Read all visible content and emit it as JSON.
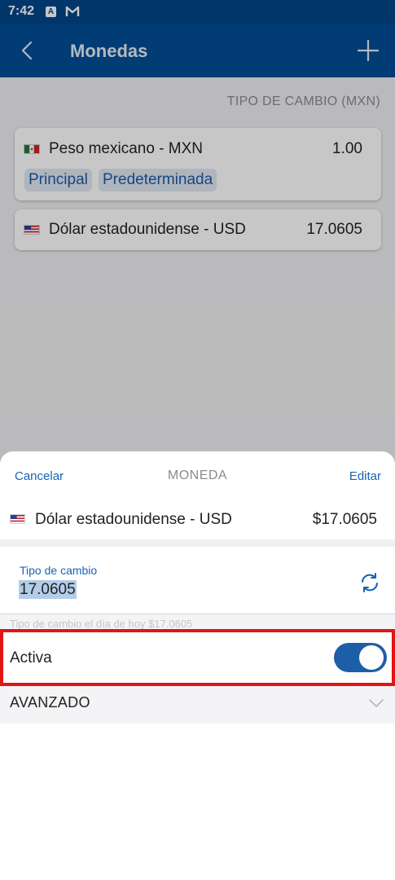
{
  "status_bar": {
    "time": "7:42",
    "icons": [
      "a-icon",
      "gmail-icon"
    ],
    "a_glyph": "A"
  },
  "app_bar": {
    "title": "Monedas",
    "back_icon": "chevron-left-icon",
    "add_icon": "plus-icon"
  },
  "list": {
    "rate_header": "TIPO DE CAMBIO (MXN)",
    "currencies": [
      {
        "flag": "mexico-flag-icon",
        "name": "Peso mexicano - MXN",
        "rate": "1.00",
        "tags": [
          "Principal",
          "Predeterminada"
        ]
      },
      {
        "flag": "usa-flag-icon",
        "name": "Dólar estadounidense - USD",
        "rate": "17.0605",
        "tags": []
      }
    ]
  },
  "sheet": {
    "cancel_label": "Cancelar",
    "title": "MONEDA",
    "edit_label": "Editar",
    "currency": {
      "flag": "usa-flag-icon",
      "name": "Dólar estadounidense - USD",
      "value": "$17.0605"
    },
    "rate_field": {
      "label": "Tipo de cambio",
      "value": "17.0605",
      "refresh_icon": "refresh-icon"
    },
    "rate_today": "Tipo de cambio el día de hoy $17.0605",
    "active": {
      "label": "Activa",
      "on": true
    },
    "advanced": {
      "label": "AVANZADO",
      "icon": "chevron-down-icon"
    }
  },
  "colors": {
    "primary": "#024e96",
    "status_bar": "#02468a",
    "link": "#1464b4",
    "toggle_on": "#1c5fa8",
    "highlight_border": "#e21515"
  }
}
